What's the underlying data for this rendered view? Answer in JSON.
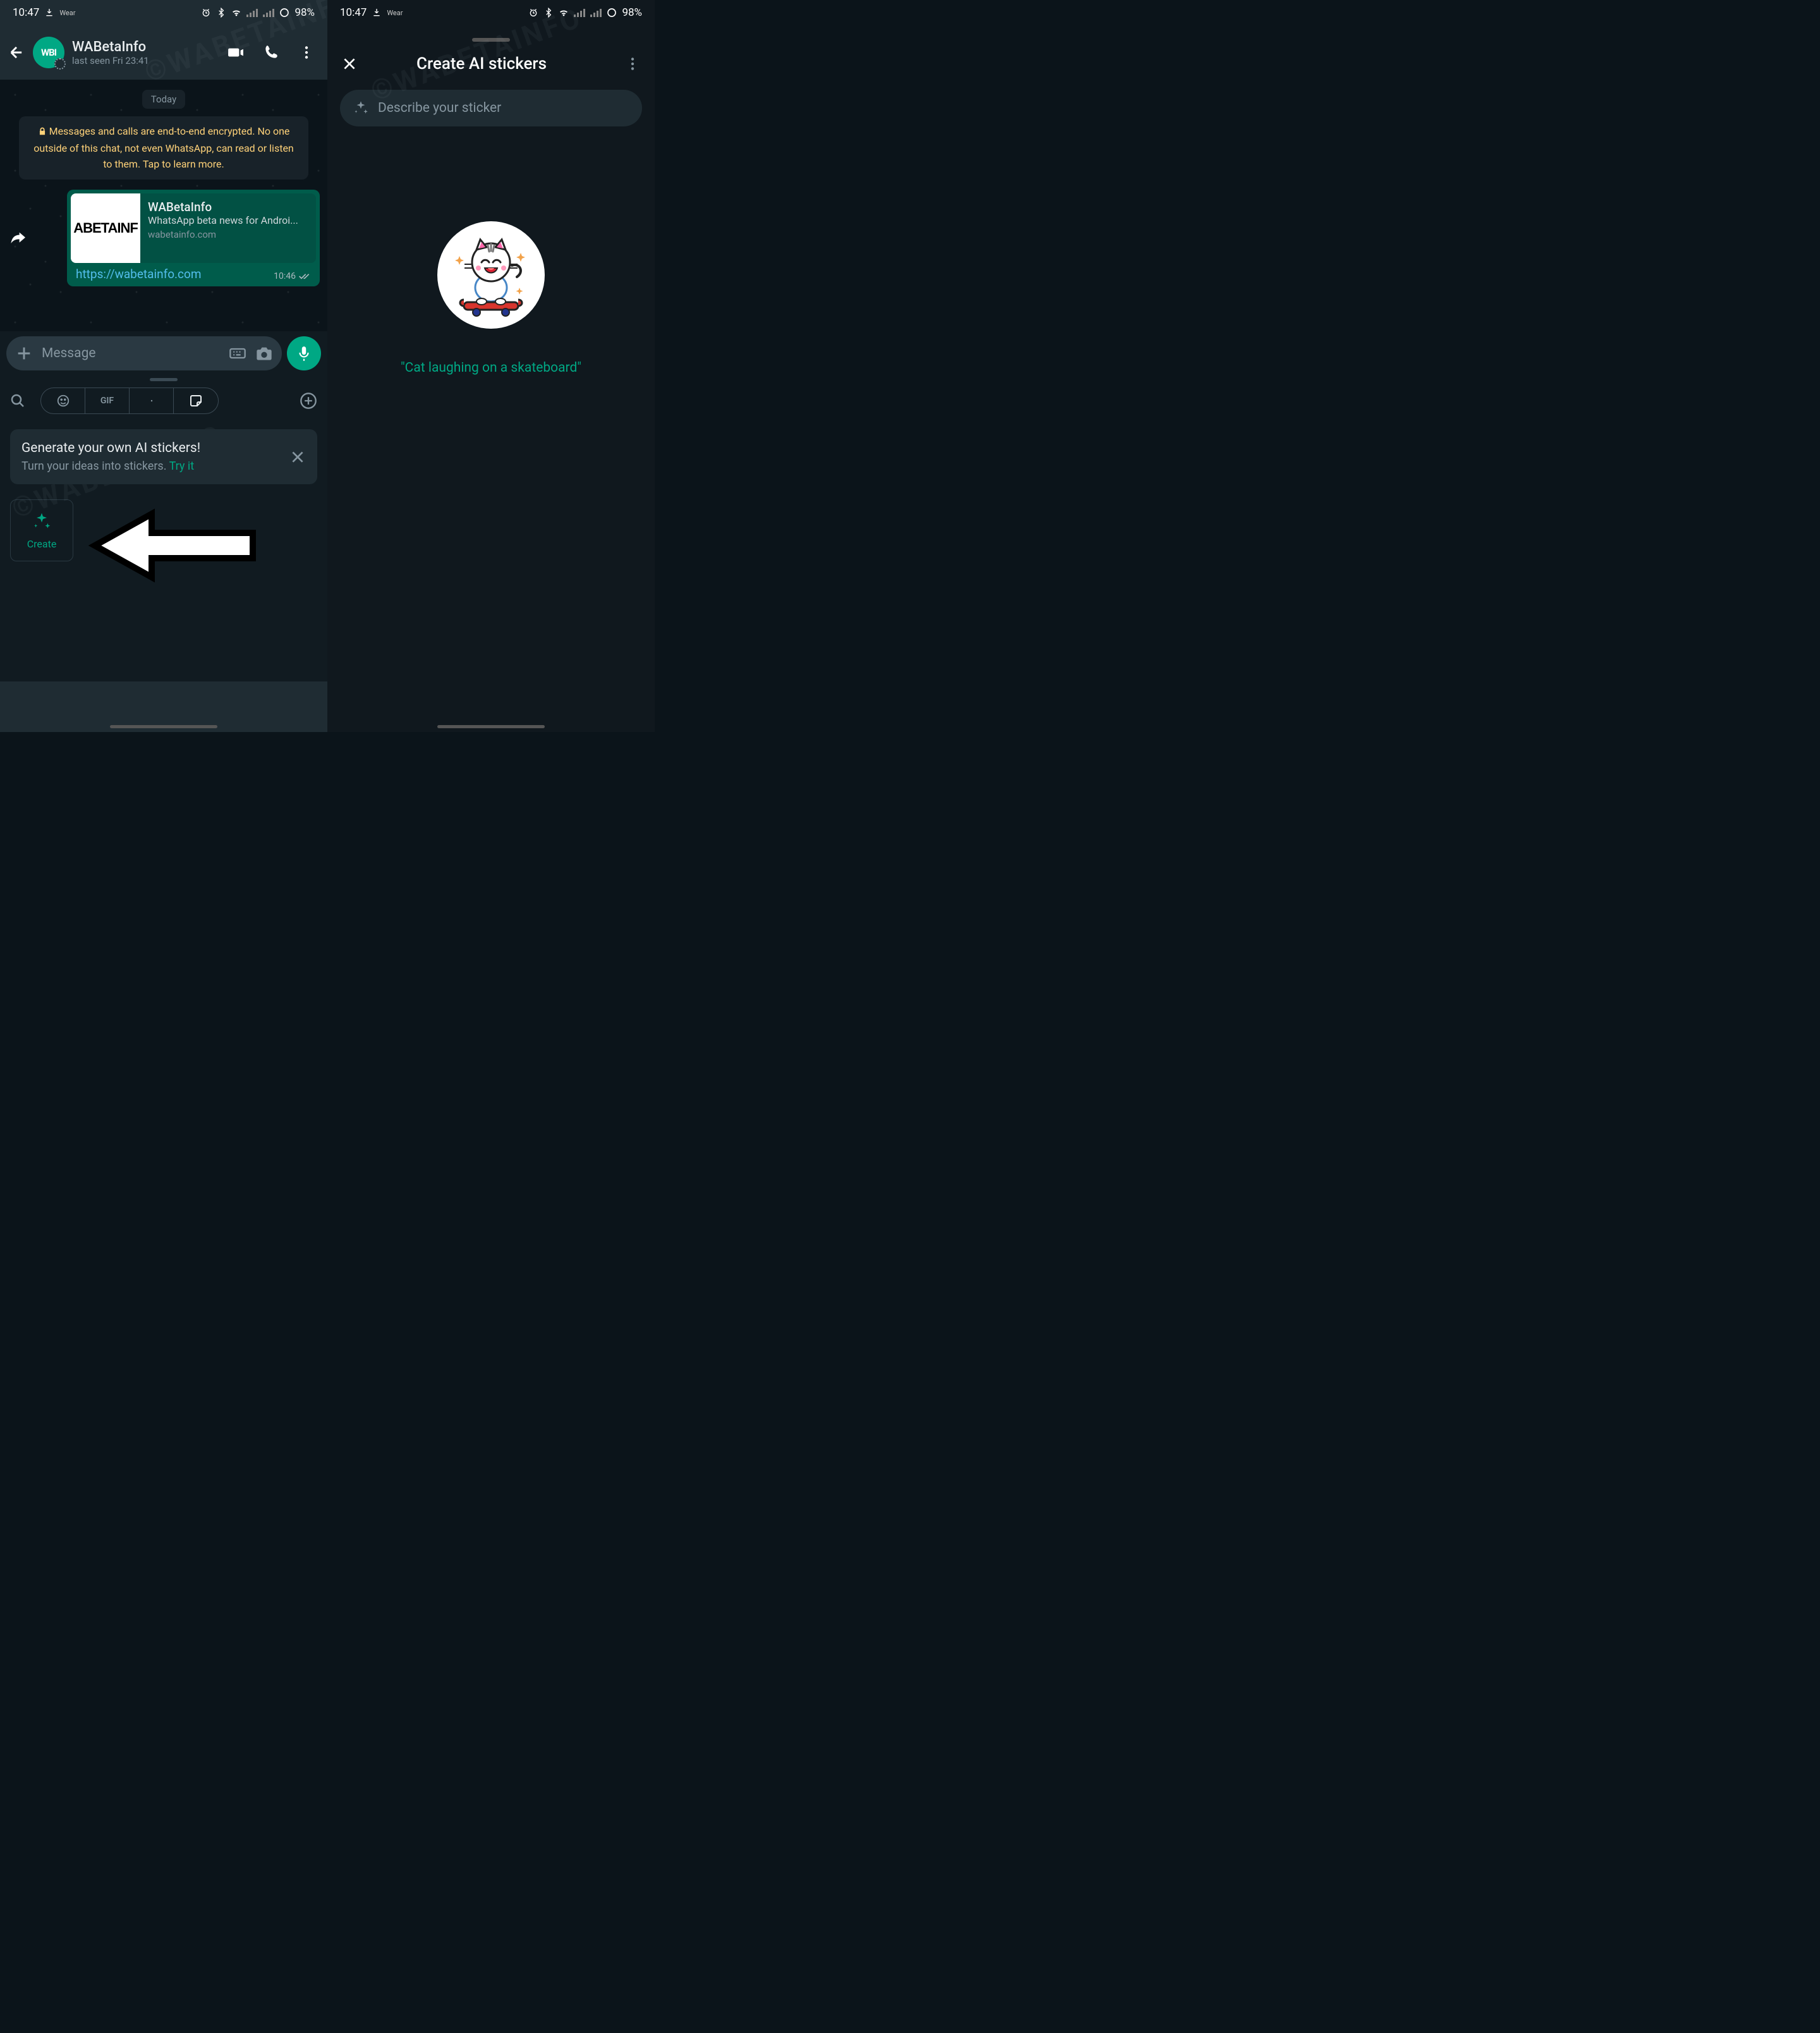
{
  "status": {
    "time": "10:47",
    "wear": "Wear",
    "battery": "98%"
  },
  "chat": {
    "name": "WABetaInfo",
    "last_seen": "last seen Fri 23:41",
    "date_label": "Today",
    "e2e_notice": "Messages and calls are end-to-end encrypted. No one outside of this chat, not even WhatsApp, can read or listen to them. Tap to learn more.",
    "link_preview": {
      "thumb_text": "ABETAINF",
      "title": "WABetaInfo",
      "desc": "WhatsApp beta news for Androi...",
      "domain": "wabetainfo.com"
    },
    "link_url": "https://wabetainfo.com",
    "msg_time": "10:46",
    "input_placeholder": "Message"
  },
  "tray": {
    "gif_label": "GIF",
    "tip_title": "Generate your own AI stickers!",
    "tip_sub": "Turn your ideas into stickers. ",
    "tip_try": "Try it",
    "create_label": "Create"
  },
  "screen2": {
    "title": "Create AI stickers",
    "placeholder": "Describe your sticker",
    "caption": "\"Cat laughing on a skateboard\""
  },
  "watermark": "©WABETAINFO",
  "avatar_text": "WBI"
}
